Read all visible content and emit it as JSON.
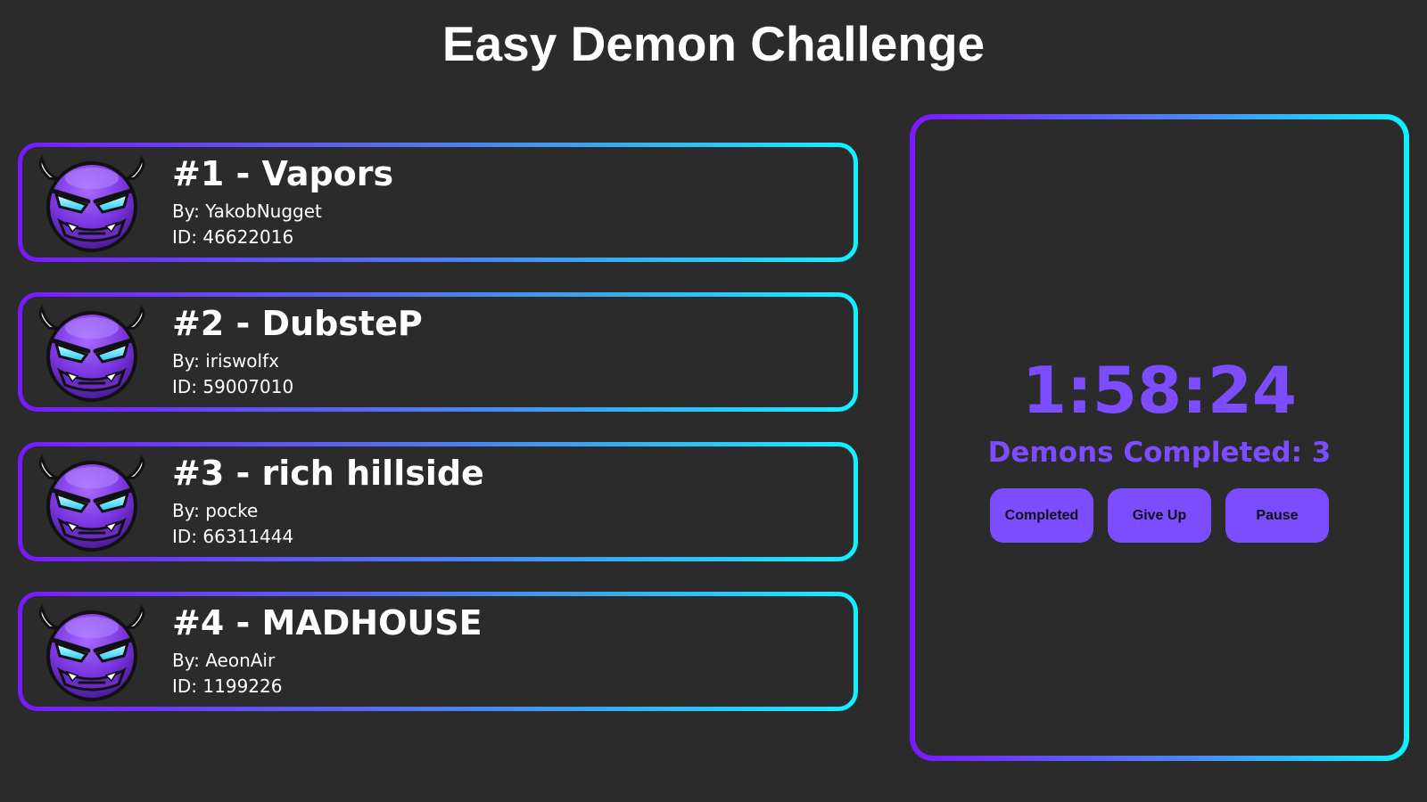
{
  "page": {
    "title": "Easy Demon Challenge"
  },
  "levels": [
    {
      "name": "#1 - Vapors",
      "creator": "By: YakobNugget",
      "id": "ID: 46622016",
      "icon": "easy-demon-face-icon"
    },
    {
      "name": "#2 - DubsteP",
      "creator": "By: iriswolfx",
      "id": "ID: 59007010",
      "icon": "easy-demon-face-icon"
    },
    {
      "name": "#3 - rich hillside",
      "creator": "By: pocke",
      "id": "ID: 66311444",
      "icon": "easy-demon-face-icon"
    },
    {
      "name": "#4 - MADHOUSE",
      "creator": "By: AeonAir",
      "id": "ID: 1199226",
      "icon": "easy-demon-face-icon"
    }
  ],
  "timer_panel": {
    "time": "1:58:24",
    "completed_text": "Demons Completed: 3",
    "buttons": {
      "completed": "Completed",
      "give_up": "Give Up",
      "pause": "Pause"
    }
  },
  "colors": {
    "background": "#2b2b2b",
    "accent_purple": "#7c4dff",
    "gradient_start": "#7a18ff",
    "gradient_end": "#13f0ff",
    "text": "#ffffff"
  }
}
